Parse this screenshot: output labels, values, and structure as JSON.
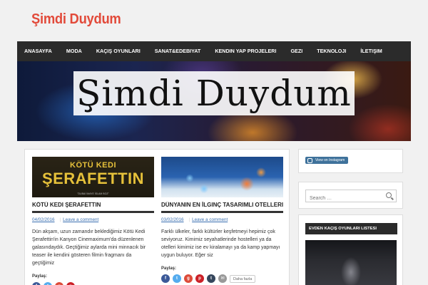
{
  "site": {
    "title": "Şimdi Duydum",
    "banner_text": "Şimdi Duydum"
  },
  "nav": {
    "items": [
      {
        "label": "ANASAYFA"
      },
      {
        "label": "MODA"
      },
      {
        "label": "KAÇIŞ OYUNLARI"
      },
      {
        "label": "SANAT&EDEBIYAT"
      },
      {
        "label": "KENDIN YAP PROJELERI"
      },
      {
        "label": "GEZI"
      },
      {
        "label": "TEKNOLOJI"
      },
      {
        "label": "İLETIŞIM"
      }
    ]
  },
  "posts": [
    {
      "image_text_1": "KÖTÜ KEDI",
      "image_text_2": "ŞERAFETTIN",
      "image_caption": "\"DUBAİ İMAYE İSLAM BOZ\"",
      "title": "KÖTÜ KEDI ŞERAFETTIN",
      "date": "04/02/2016",
      "comment_link": "Leave a comment",
      "excerpt": "Dün akşam, uzun zamandır beklediğimiz Kötü Kedi Şerafettin'in Kanyon Cinemaximum'da düzenlenen galasındaydık. Geçtiğimiz aylarda mini minnacık bir teaser ile kendini gösteren filmin fragmanı da geçtiğimiz",
      "share_label": "Paylaş:"
    },
    {
      "title": "DÜNYANIN EN İLGINÇ TASARIMLI OTELLERI",
      "date": "03/02/2016",
      "comment_link": "Leave a comment",
      "excerpt": "Farklı ülkeler, farklı kültürler keşfetmeyi hepimiz çok seviyoruz. Kimimiz seyahatlerinde hostelleri ya da otelleri kimimiz ise ev kiralamayı ya da kamp yapmayı uygun buluyor. Eğer siz",
      "share_label": "Paylaş:",
      "more_label": "Daha fazla"
    }
  ],
  "sidebar": {
    "instagram_label": "View on Instagram",
    "search_placeholder": "Search …",
    "widget_title": "EVDEN KAÇIŞ OYUNLARI LISTESI"
  },
  "colors": {
    "accent": "#e24a3a",
    "nav_bg": "#2b2b2b",
    "link": "#3a6fb0",
    "share_facebook": "#3b5998",
    "share_twitter": "#55acee",
    "share_google": "#dd4b39",
    "share_pinterest": "#cb2027",
    "share_tumblr": "#35465c",
    "share_email": "#999999"
  }
}
